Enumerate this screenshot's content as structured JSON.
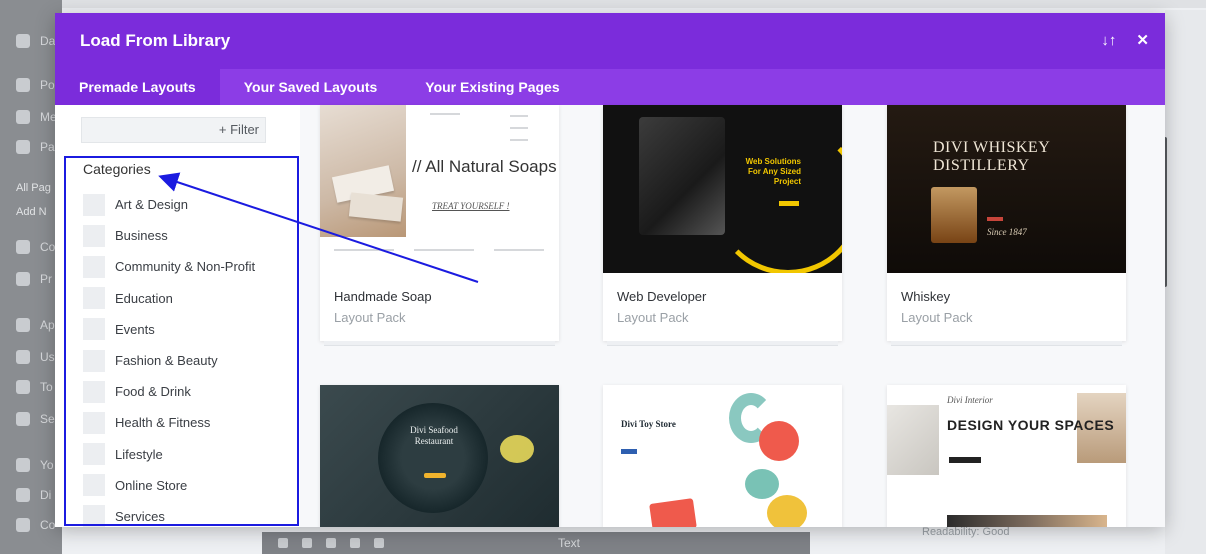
{
  "modal": {
    "title": "Load From Library",
    "header_buttons": {
      "sort_glyph": "↓↑",
      "close_glyph": "✕"
    },
    "tabs": [
      {
        "label": "Premade Layouts",
        "active": true
      },
      {
        "label": "Your Saved Layouts",
        "active": false
      },
      {
        "label": "Your Existing Pages",
        "active": false
      }
    ],
    "accent_color": "#7b2cdb"
  },
  "filter": {
    "button_label": "+ Filter",
    "placeholder": ""
  },
  "categories": {
    "title": "Categories",
    "items": [
      "Art & Design",
      "Business",
      "Community & Non-Profit",
      "Education",
      "Events",
      "Fashion & Beauty",
      "Food & Drink",
      "Health & Fitness",
      "Lifestyle",
      "Online Store",
      "Services"
    ]
  },
  "layouts": [
    {
      "name": "Handmade Soap",
      "type": "Layout Pack",
      "thumb_text": "// All Natural Soaps",
      "thumb_sub": "TREAT YOURSELF !"
    },
    {
      "name": "Web Developer",
      "type": "Layout Pack",
      "thumb_text": "Web Solutions For Any Sized Project"
    },
    {
      "name": "Whiskey",
      "type": "Layout Pack",
      "thumb_text": "DIVI WHISKEY DISTILLERY",
      "thumb_sub": "Since 1847"
    },
    {
      "thumb_text": "Divi Seafood Restaurant"
    },
    {
      "thumb_text": "Divi Toy Store"
    },
    {
      "thumb_text": "DESIGN YOUR SPACES",
      "thumb_sub": "Divi Interior"
    }
  ],
  "background": {
    "bottom_toolbar_text": "Text",
    "bottom_right_text": "Readability: Good",
    "sidebar_items": [
      "Da",
      "Po",
      "Me",
      "Pa",
      "All Pag",
      "Add N",
      "Co",
      "Pr",
      "Ap",
      "Us",
      "To",
      "Se",
      "Yo",
      "Di",
      "Co"
    ]
  },
  "annotation_color": "#1b1be0"
}
